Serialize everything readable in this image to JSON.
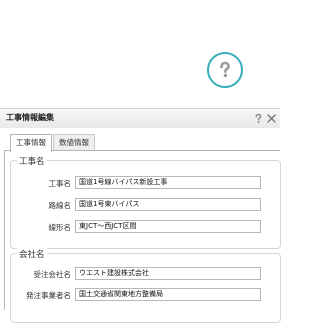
{
  "dialog": {
    "title": "工事情報編集",
    "help_icon": "question-mark-icon",
    "close_icon": "close-icon"
  },
  "help_button": {
    "icon": "question-mark-icon",
    "accent": "#36aeb9"
  },
  "tabs": [
    {
      "label": "工事情報",
      "active": true
    },
    {
      "label": "数値情報",
      "active": false
    }
  ],
  "sections": {
    "construction": {
      "heading": "工事名",
      "fields": [
        {
          "label": "工事名",
          "value": "国道1号線バイパス新設工事"
        },
        {
          "label": "路線名",
          "value": "国道1号東バイパス"
        },
        {
          "label": "線形名",
          "value": "東JCT～西JCT区間"
        }
      ]
    },
    "company": {
      "heading": "会社名",
      "fields": [
        {
          "label": "受注会社名",
          "value": "ウエスト建設株式会社"
        },
        {
          "label": "発注事業者名",
          "value": "国土交通省関東地方整備局"
        }
      ]
    }
  }
}
